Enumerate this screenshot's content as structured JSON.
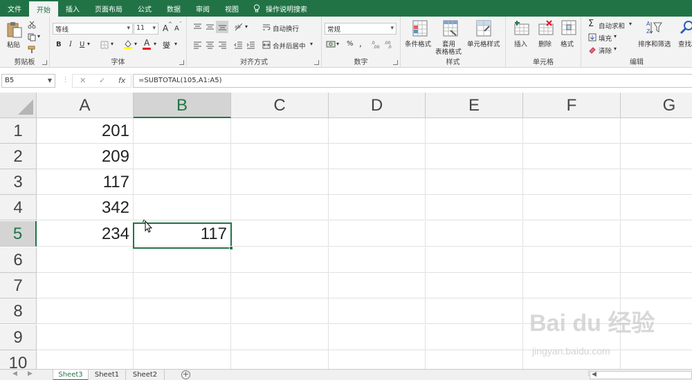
{
  "app": {
    "accent": "#217346"
  },
  "menu": {
    "tabs": [
      "文件",
      "开始",
      "插入",
      "页面布局",
      "公式",
      "数据",
      "审阅",
      "视图"
    ],
    "active_index": 1,
    "tell_me": "操作说明搜索"
  },
  "ribbon": {
    "clipboard": {
      "label": "剪贴板",
      "paste": "粘贴"
    },
    "font": {
      "label": "字体",
      "name": "等线",
      "size": "11",
      "bold": "B",
      "italic": "I",
      "underline": "U",
      "grow": "A",
      "shrink": "A",
      "color_letter": "A"
    },
    "alignment": {
      "label": "对齐方式",
      "wrap": "自动换行",
      "merge": "合并后居中"
    },
    "number": {
      "label": "数字",
      "format": "常规",
      "percent": "%"
    },
    "styles": {
      "label": "样式",
      "conditional": "条件格式",
      "table_line1": "套用",
      "table_line2": "表格格式",
      "cell_styles": "单元格样式"
    },
    "cells": {
      "label": "单元格",
      "insert": "插入",
      "delete": "删除",
      "format": "格式"
    },
    "editing": {
      "label": "编辑",
      "autosum": "自动求和",
      "fill": "填充",
      "clear": "清除",
      "sort_filter": "排序和筛选",
      "find_select": "查找和"
    }
  },
  "formula_bar": {
    "name_box": "B5",
    "cancel": "✕",
    "enter": "✓",
    "fx": "fx",
    "formula": "=SUBTOTAL(105,A1:A5)"
  },
  "sheet": {
    "columns": [
      "A",
      "B",
      "C",
      "D",
      "E",
      "F",
      "G"
    ],
    "selected_column": "B",
    "rows": [
      "1",
      "2",
      "3",
      "4",
      "5",
      "6",
      "7",
      "8",
      "9",
      "10"
    ],
    "selected_row": "5",
    "cells": {
      "A1": "201",
      "A2": "209",
      "A3": "117",
      "A4": "342",
      "A5": "234",
      "B5": "117"
    }
  },
  "sheet_tabs": {
    "tabs": [
      "Sheet3",
      "Sheet1",
      "Sheet2"
    ],
    "active_index": 0,
    "add": "+"
  },
  "watermark": {
    "text": "Bai du 经验",
    "sub": "jingyan.baidu.com"
  }
}
